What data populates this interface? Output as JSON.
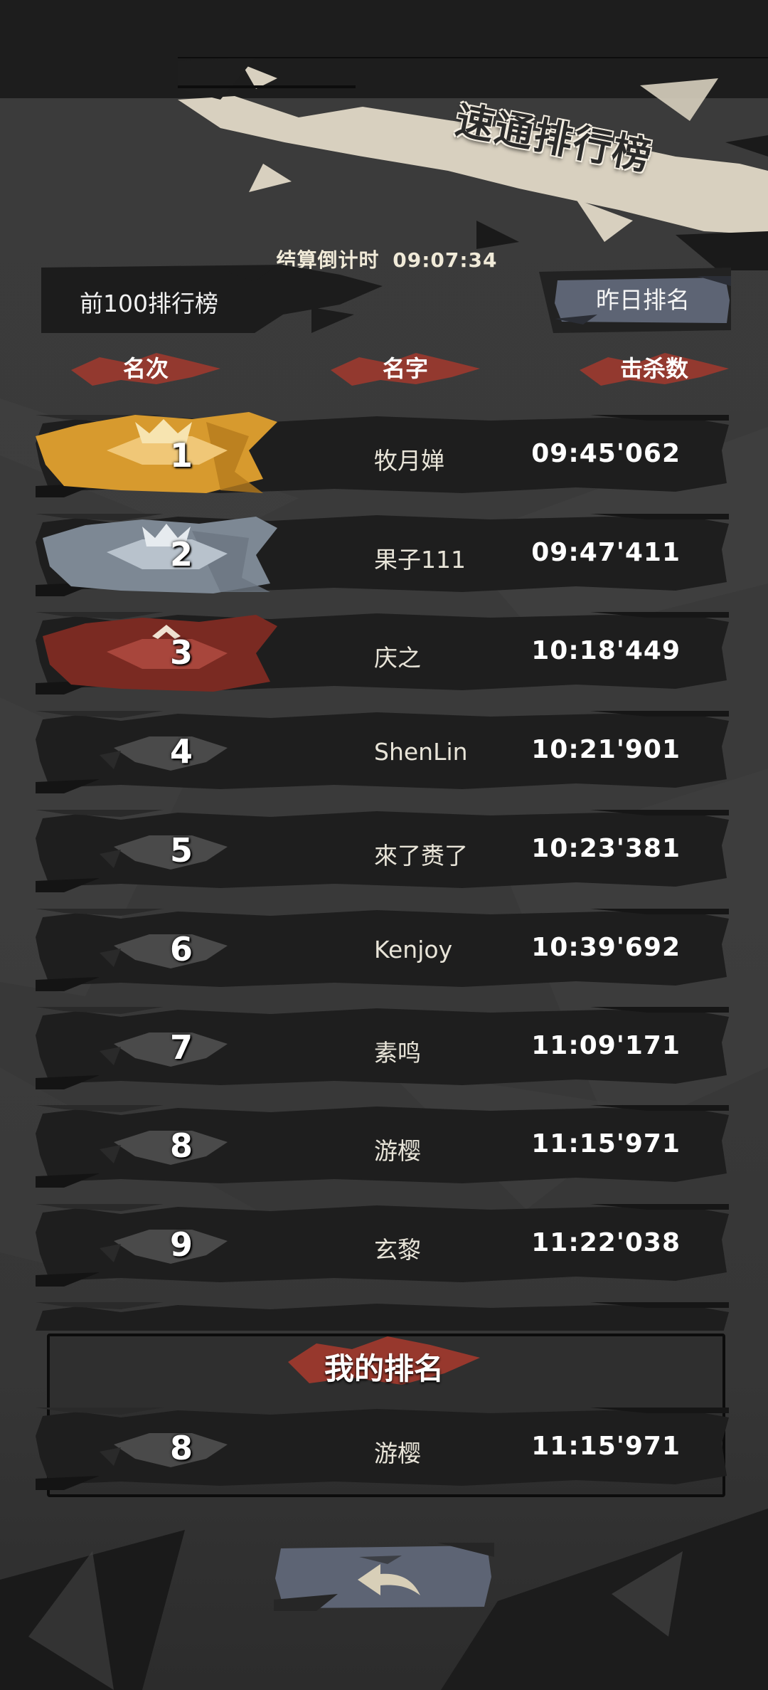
{
  "leaderboard_title": "速通排行榜",
  "countdown": {
    "label": "结算倒计时",
    "value": "09:07:34"
  },
  "tab": {
    "label": "前100排行榜",
    "yesterday_button": "昨日排名"
  },
  "columns": {
    "rank": "名次",
    "name": "名字",
    "score": "击杀数"
  },
  "rows": [
    {
      "rank": "1",
      "name": "牧月婵",
      "score": "09:45'062"
    },
    {
      "rank": "2",
      "name": "果子111",
      "score": "09:47'411"
    },
    {
      "rank": "3",
      "name": "庆之",
      "score": "10:18'449"
    },
    {
      "rank": "4",
      "name": "ShenLin",
      "score": "10:21'901"
    },
    {
      "rank": "5",
      "name": "來了赉了",
      "score": "10:23'381"
    },
    {
      "rank": "6",
      "name": "Kenjoy",
      "score": "10:39'692"
    },
    {
      "rank": "7",
      "name": "素鸣",
      "score": "11:09'171"
    },
    {
      "rank": "8",
      "name": "游樱",
      "score": "11:15'971"
    },
    {
      "rank": "9",
      "name": "玄黎",
      "score": "11:22'038"
    }
  ],
  "my_rank": {
    "title": "我的排名",
    "rank": "8",
    "name": "游樱",
    "score": "11:15'971"
  },
  "icons": {
    "back_button": "back-arrow-icon",
    "rank1_badge": "gold-crown-icon",
    "rank2_badge": "silver-crown-icon",
    "rank3_badge": "bronze-chevron-icon"
  },
  "colors": {
    "gold": "#d79a2e",
    "silver": "#8d98a6",
    "bronze": "#8a2b24",
    "accent_red": "#a33a2e",
    "banner_paper": "#d8d0bf",
    "button_blue": "#5d6474"
  }
}
